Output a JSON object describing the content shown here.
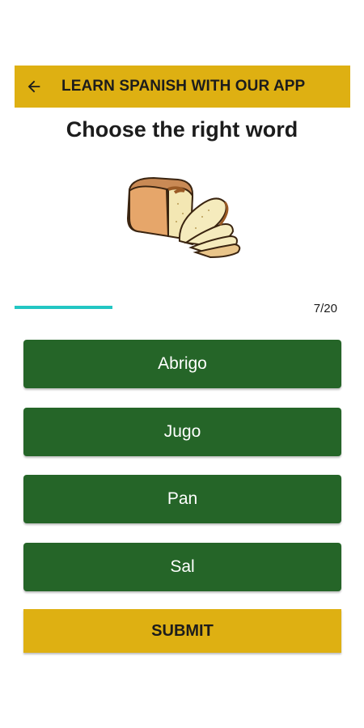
{
  "app_bar": {
    "back_icon": "arrow-left-icon",
    "title": "LEARN SPANISH WITH OUR APP",
    "background": "#deb012"
  },
  "question": {
    "prompt": "Choose the right word",
    "image_icon": "bread-loaf-icon"
  },
  "progress": {
    "current": 7,
    "total": 20,
    "label": "7/20",
    "fraction": 0.35,
    "color": "#23c6c3"
  },
  "options": [
    {
      "label": "Abrigo"
    },
    {
      "label": "Jugo"
    },
    {
      "label": "Pan"
    },
    {
      "label": "Sal"
    }
  ],
  "option_color": "#256528",
  "submit": {
    "label": "SUBMIT",
    "background": "#deb012"
  }
}
